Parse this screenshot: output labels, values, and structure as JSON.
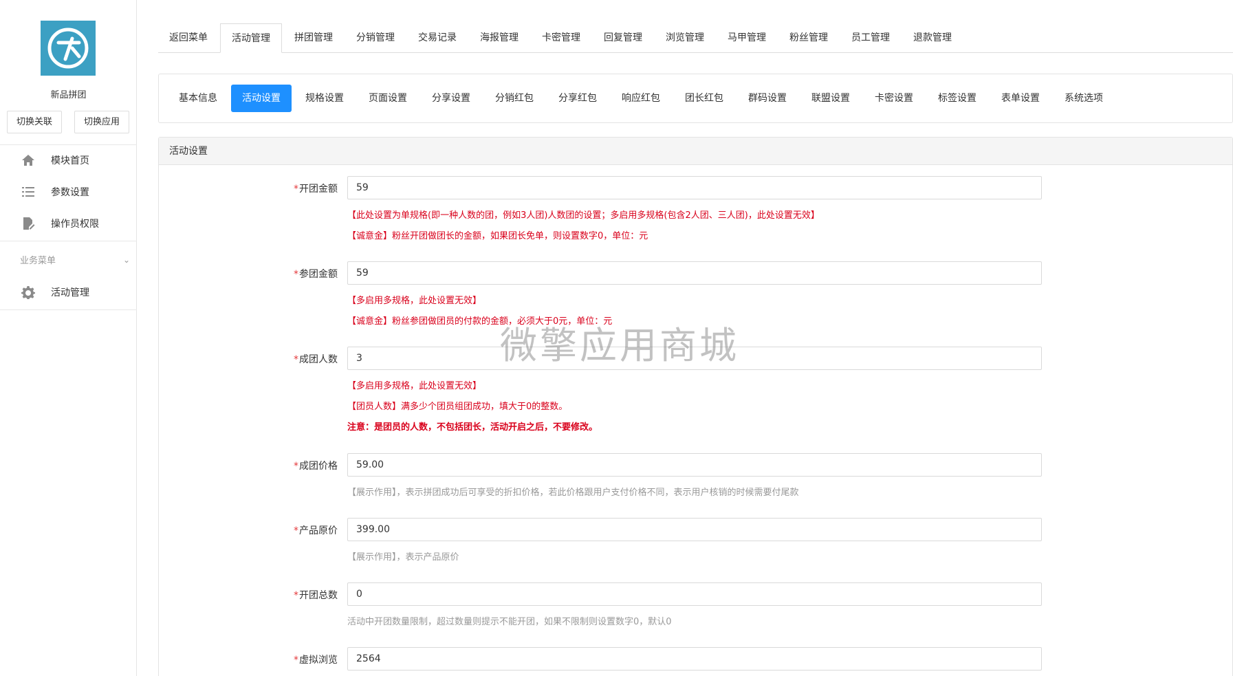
{
  "sidebar": {
    "app_name": "新品拼团",
    "switch_link": "切换关联",
    "switch_app": "切换应用",
    "menu": [
      {
        "label": "模块首页",
        "icon": "home-icon"
      },
      {
        "label": "参数设置",
        "icon": "list-icon"
      },
      {
        "label": "操作员权限",
        "icon": "document-edit-icon"
      }
    ],
    "group_label": "业务菜单",
    "group_items": [
      {
        "label": "活动管理",
        "icon": "gear-icon"
      }
    ]
  },
  "top_tabs": [
    "返回菜单",
    "活动管理",
    "拼团管理",
    "分销管理",
    "交易记录",
    "海报管理",
    "卡密管理",
    "回复管理",
    "浏览管理",
    "马甲管理",
    "粉丝管理",
    "员工管理",
    "退款管理"
  ],
  "top_tabs_active": 1,
  "sub_tabs": [
    "基本信息",
    "活动设置",
    "规格设置",
    "页面设置",
    "分享设置",
    "分销红包",
    "分享红包",
    "响应红包",
    "团长红包",
    "群码设置",
    "联盟设置",
    "卡密设置",
    "标签设置",
    "表单设置",
    "系统选项"
  ],
  "sub_tabs_active": 1,
  "panel_title": "活动设置",
  "fields": {
    "open_amount": {
      "label": "开团金额",
      "value": "59",
      "hint1": "【此处设置为单规格(即一种人数的团，例如3人团)人数团的设置；多启用多规格(包含2人团、三人团)，此处设置无效】",
      "hint2": "【诚意金】粉丝开团做团长的金额，如果团长免单，则设置数字0，单位：元"
    },
    "join_amount": {
      "label": "参团金额",
      "value": "59",
      "hint1": "【多启用多规格，此处设置无效】",
      "hint2": "【诚意金】粉丝参团做团员的付款的金额，必须大于0元，单位：元"
    },
    "group_size": {
      "label": "成团人数",
      "value": "3",
      "hint1": "【多启用多规格，此处设置无效】",
      "hint2": "【团员人数】满多少个团员组团成功，填大于0的整数。",
      "hint3": "注意：是团员的人数，不包括团长，活动开启之后，不要修改。"
    },
    "group_price": {
      "label": "成团价格",
      "value": "59.00",
      "hint1": "【展示作用】，表示拼团成功后可享受的折扣价格，若此价格跟用户支付价格不同，表示用户核销的时候需要付尾款"
    },
    "original_price": {
      "label": "产品原价",
      "value": "399.00",
      "hint1": "【展示作用】，表示产品原价"
    },
    "open_total": {
      "label": "开团总数",
      "value": "0",
      "hint1": "活动中开团数量限制，超过数量则提示不能开团，如果不限制则设置数字0，默认0"
    },
    "virtual_views": {
      "label": "虚拟浏览",
      "value": "2564"
    }
  },
  "required_mark": "*",
  "watermark": "微擎应用商城",
  "colors": {
    "accent": "#1e90ff",
    "logo_bg": "#3ca0c3",
    "hint_red": "#d9001b",
    "hint_gray": "#999999"
  }
}
